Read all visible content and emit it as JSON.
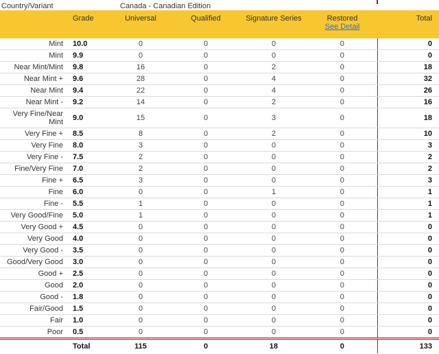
{
  "variant": {
    "label": "Country/Variant",
    "value": "Canada - Canadian Edition"
  },
  "columns": {
    "grade": "Grade",
    "universal": "Universal",
    "qualified": "Qualified",
    "signature": "Signature Series",
    "restored": "Restored",
    "see_detail": "See Detail",
    "total": "Total"
  },
  "rows": [
    {
      "label": "Mint",
      "grade": "10.0",
      "universal": "0",
      "qualified": "0",
      "signature": "0",
      "restored": "0",
      "total": "0"
    },
    {
      "label": "Mint",
      "grade": "9.9",
      "universal": "0",
      "qualified": "0",
      "signature": "0",
      "restored": "0",
      "total": "0"
    },
    {
      "label": "Near Mint/Mint",
      "grade": "9.8",
      "universal": "16",
      "qualified": "0",
      "signature": "2",
      "restored": "0",
      "total": "18"
    },
    {
      "label": "Near Mint +",
      "grade": "9.6",
      "universal": "28",
      "qualified": "0",
      "signature": "4",
      "restored": "0",
      "total": "32"
    },
    {
      "label": "Near Mint",
      "grade": "9.4",
      "universal": "22",
      "qualified": "0",
      "signature": "4",
      "restored": "0",
      "total": "26"
    },
    {
      "label": "Near Mint -",
      "grade": "9.2",
      "universal": "14",
      "qualified": "0",
      "signature": "2",
      "restored": "0",
      "total": "16"
    },
    {
      "label": "Very Fine/Near Mint",
      "grade": "9.0",
      "universal": "15",
      "qualified": "0",
      "signature": "3",
      "restored": "0",
      "total": "18",
      "tall": true
    },
    {
      "label": "Very Fine +",
      "grade": "8.5",
      "universal": "8",
      "qualified": "0",
      "signature": "2",
      "restored": "0",
      "total": "10"
    },
    {
      "label": "Very Fine",
      "grade": "8.0",
      "universal": "3",
      "qualified": "0",
      "signature": "0",
      "restored": "0",
      "total": "3"
    },
    {
      "label": "Very Fine -",
      "grade": "7.5",
      "universal": "2",
      "qualified": "0",
      "signature": "0",
      "restored": "0",
      "total": "2"
    },
    {
      "label": "Fine/Very Fine",
      "grade": "7.0",
      "universal": "2",
      "qualified": "0",
      "signature": "0",
      "restored": "0",
      "total": "2"
    },
    {
      "label": "Fine +",
      "grade": "6.5",
      "universal": "3",
      "qualified": "0",
      "signature": "0",
      "restored": "0",
      "total": "3"
    },
    {
      "label": "Fine",
      "grade": "6.0",
      "universal": "0",
      "qualified": "0",
      "signature": "1",
      "restored": "0",
      "total": "1"
    },
    {
      "label": "Fine -",
      "grade": "5.5",
      "universal": "1",
      "qualified": "0",
      "signature": "0",
      "restored": "0",
      "total": "1"
    },
    {
      "label": "Very Good/Fine",
      "grade": "5.0",
      "universal": "1",
      "qualified": "0",
      "signature": "0",
      "restored": "0",
      "total": "1"
    },
    {
      "label": "Very Good +",
      "grade": "4.5",
      "universal": "0",
      "qualified": "0",
      "signature": "0",
      "restored": "0",
      "total": "0"
    },
    {
      "label": "Very Good",
      "grade": "4.0",
      "universal": "0",
      "qualified": "0",
      "signature": "0",
      "restored": "0",
      "total": "0"
    },
    {
      "label": "Very Good -",
      "grade": "3.5",
      "universal": "0",
      "qualified": "0",
      "signature": "0",
      "restored": "0",
      "total": "0"
    },
    {
      "label": "Good/Very Good",
      "grade": "3.0",
      "universal": "0",
      "qualified": "0",
      "signature": "0",
      "restored": "0",
      "total": "0"
    },
    {
      "label": "Good +",
      "grade": "2.5",
      "universal": "0",
      "qualified": "0",
      "signature": "0",
      "restored": "0",
      "total": "0"
    },
    {
      "label": "Good",
      "grade": "2.0",
      "universal": "0",
      "qualified": "0",
      "signature": "0",
      "restored": "0",
      "total": "0"
    },
    {
      "label": "Good -",
      "grade": "1.8",
      "universal": "0",
      "qualified": "0",
      "signature": "0",
      "restored": "0",
      "total": "0"
    },
    {
      "label": "Fair/Good",
      "grade": "1.5",
      "universal": "0",
      "qualified": "0",
      "signature": "0",
      "restored": "0",
      "total": "0"
    },
    {
      "label": "Fair",
      "grade": "1.0",
      "universal": "0",
      "qualified": "0",
      "signature": "0",
      "restored": "0",
      "total": "0"
    },
    {
      "label": "Poor",
      "grade": "0.5",
      "universal": "0",
      "qualified": "0",
      "signature": "0",
      "restored": "0",
      "total": "0"
    }
  ],
  "totals": {
    "label": "Total",
    "universal": "115",
    "qualified": "0",
    "signature": "18",
    "restored": "0",
    "total": "133"
  },
  "colors": {
    "header_bg": "#f8c72f",
    "divider_red": "#d0021b",
    "link_blue": "#3a6fbf"
  }
}
